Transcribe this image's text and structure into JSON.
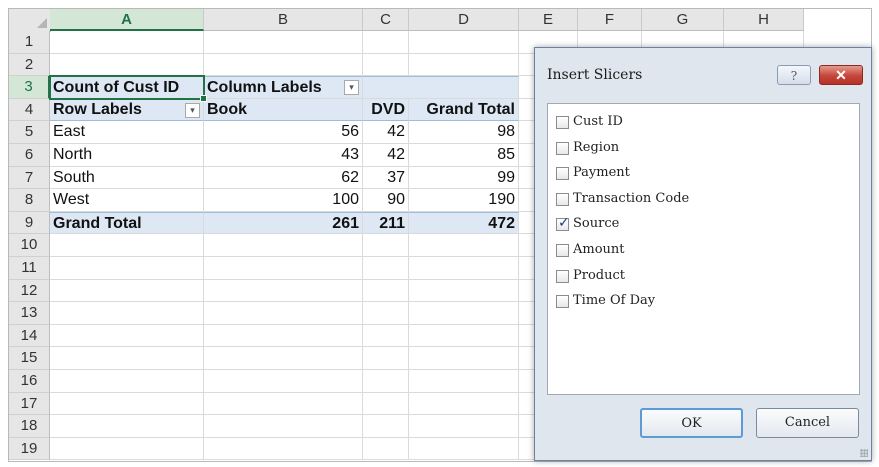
{
  "sheet": {
    "columns": [
      "A",
      "B",
      "C",
      "D",
      "E",
      "F",
      "G",
      "H"
    ],
    "rows": [
      "1",
      "2",
      "3",
      "4",
      "5",
      "6",
      "7",
      "8",
      "9",
      "10",
      "11",
      "12",
      "13",
      "14",
      "15",
      "16",
      "17",
      "18",
      "19"
    ],
    "pivot": {
      "corner_label": "Count of Cust ID",
      "column_labels": "Column Labels",
      "row_labels": "Row Labels",
      "col_headers": [
        "Book",
        "DVD",
        "Grand Total"
      ],
      "data_rows": [
        {
          "label": "East",
          "values": [
            "56",
            "42",
            "98"
          ]
        },
        {
          "label": "North",
          "values": [
            "43",
            "42",
            "85"
          ]
        },
        {
          "label": "South",
          "values": [
            "62",
            "37",
            "99"
          ]
        },
        {
          "label": "West",
          "values": [
            "100",
            "90",
            "190"
          ]
        }
      ],
      "grand_total": {
        "label": "Grand Total",
        "values": [
          "261",
          "211",
          "472"
        ]
      },
      "filter_glyph": "▾"
    }
  },
  "dialog": {
    "title": "Insert Slicers",
    "help_label": "?",
    "close_label": "✕",
    "fields": [
      {
        "label": "Cust ID",
        "checked": false
      },
      {
        "label": "Region",
        "checked": false
      },
      {
        "label": "Payment",
        "checked": false
      },
      {
        "label": "Transaction Code",
        "checked": false
      },
      {
        "label": "Source",
        "checked": true
      },
      {
        "label": "Amount",
        "checked": false
      },
      {
        "label": "Product",
        "checked": false
      },
      {
        "label": "Time Of Day",
        "checked": false
      }
    ],
    "check_glyph": "✓",
    "ok_label": "OK",
    "cancel_label": "Cancel"
  },
  "colors": {
    "accent_green": "#217346",
    "pivot_band": "#dde8f4",
    "close_red": "#c4463a"
  }
}
